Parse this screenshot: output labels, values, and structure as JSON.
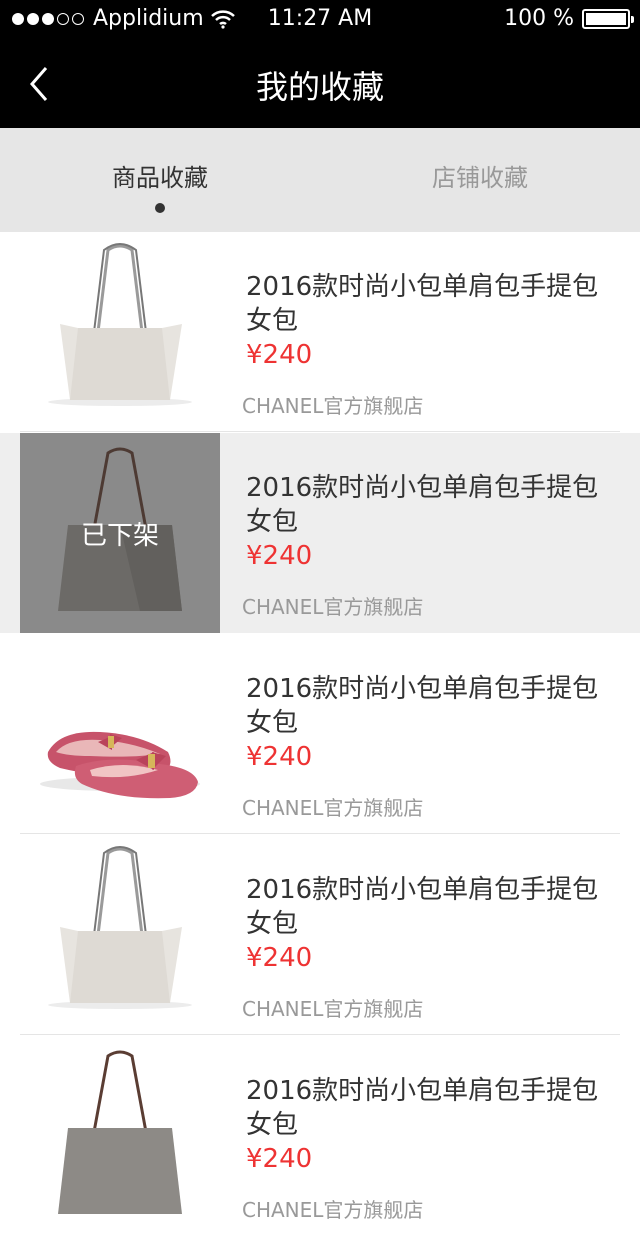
{
  "status_bar": {
    "carrier": "Applidium",
    "time": "11:27 AM",
    "battery": "100 %",
    "icons": [
      "signal-dots",
      "wifi-icon",
      "battery-icon"
    ]
  },
  "nav": {
    "title": "我的收藏",
    "back_icon": "chevron-left-icon"
  },
  "tabs": [
    {
      "label": "商品收藏",
      "active": true
    },
    {
      "label": "店铺收藏",
      "active": false
    }
  ],
  "items": [
    {
      "title": "2016款时尚小包单肩包手提包女包",
      "price": "¥240",
      "store": "CHANEL官方旗舰店",
      "image": "white-tote-bag",
      "removed": false,
      "status": ""
    },
    {
      "title": "2016款时尚小包单肩包手提包女包",
      "price": "¥240",
      "store": "CHANEL官方旗舰店",
      "image": "gray-tote-bag",
      "removed": true,
      "status": "已下架"
    },
    {
      "title": "2016款时尚小包单肩包手提包女包",
      "price": "¥240",
      "store": "CHANEL官方旗舰店",
      "image": "pink-flats",
      "removed": false,
      "status": ""
    },
    {
      "title": "2016款时尚小包单肩包手提包女包",
      "price": "¥240",
      "store": "CHANEL官方旗舰店",
      "image": "white-tote-bag",
      "removed": false,
      "status": ""
    },
    {
      "title": "2016款时尚小包单肩包手提包女包",
      "price": "¥240",
      "store": "CHANEL官方旗舰店",
      "image": "gray-tote-bag",
      "removed": false,
      "status": ""
    }
  ],
  "colors": {
    "price": "#ee3333",
    "nav_bg": "#000000",
    "tab_bg": "#e6e6e6"
  }
}
